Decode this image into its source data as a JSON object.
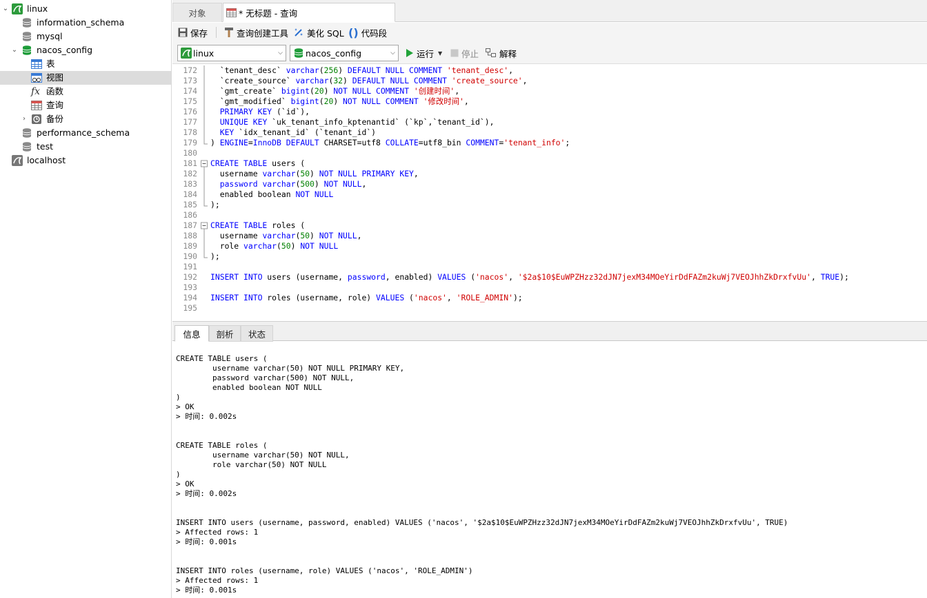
{
  "tree": {
    "connection": "linux",
    "databases": [
      "information_schema",
      "mysql",
      "nacos_config"
    ],
    "nacos_children": [
      "表",
      "视图",
      "函数",
      "查询",
      "备份"
    ],
    "more_databases": [
      "performance_schema",
      "test"
    ],
    "other_connection": "localhost"
  },
  "tabs": {
    "objects": "对象",
    "query_tab": "* 无标题 - 查询"
  },
  "toolbar": {
    "save": "保存",
    "query_builder": "查询创建工具",
    "beautify": "美化 SQL",
    "snippet": "代码段",
    "connection": "linux",
    "database": "nacos_config",
    "run": "运行",
    "stop": "停止",
    "explain": "解释"
  },
  "colors": {
    "keyword": "#0000ff",
    "string": "#d00000",
    "number": "#008000",
    "selected_row": "#dcdcdc"
  },
  "editor": {
    "lines": [
      {
        "n": "172",
        "html": "  `tenant_desc` <span class='kw'>varchar</span>(<span class='num'>256</span>) <span class='kw'>DEFAULT NULL COMMENT</span> <span class='str'>'tenant_desc'</span>,"
      },
      {
        "n": "173",
        "html": "  `create_source` <span class='kw'>varchar</span>(<span class='num'>32</span>) <span class='kw'>DEFAULT NULL COMMENT</span> <span class='str'>'create_source'</span>,"
      },
      {
        "n": "174",
        "html": "  `gmt_create` <span class='kw'>bigint</span>(<span class='num'>20</span>) <span class='kw'>NOT NULL COMMENT</span> <span class='str'>'创建时间'</span>,"
      },
      {
        "n": "175",
        "html": "  `gmt_modified` <span class='kw'>bigint</span>(<span class='num'>20</span>) <span class='kw'>NOT NULL COMMENT</span> <span class='str'>'修改时间'</span>,"
      },
      {
        "n": "176",
        "html": "  <span class='kw'>PRIMARY KEY</span> (`id`),"
      },
      {
        "n": "177",
        "html": "  <span class='kw'>UNIQUE KEY</span> `uk_tenant_info_kptenantid` (`kp`,`tenant_id`),"
      },
      {
        "n": "178",
        "html": "  <span class='kw'>KEY</span> `idx_tenant_id` (`tenant_id`)"
      },
      {
        "n": "179",
        "html": ") <span class='kw'>ENGINE</span>=<span class='kw'>InnoDB</span> <span class='kw'>DEFAULT</span> CHARSET=utf8 <span class='kw'>COLLATE</span>=utf8_bin <span class='kw'>COMMENT</span>=<span class='str'>'tenant_info'</span>;"
      },
      {
        "n": "180",
        "html": ""
      },
      {
        "n": "181",
        "html": "<span class='kw'>CREATE TABLE</span> users ("
      },
      {
        "n": "182",
        "html": "  username <span class='kw'>varchar</span>(<span class='num'>50</span>) <span class='kw'>NOT NULL PRIMARY KEY</span>,"
      },
      {
        "n": "183",
        "html": "  <span class='kw'>password</span> <span class='kw'>varchar</span>(<span class='num'>500</span>) <span class='kw'>NOT NULL</span>,"
      },
      {
        "n": "184",
        "html": "  enabled boolean <span class='kw'>NOT NULL</span>"
      },
      {
        "n": "185",
        "html": ");"
      },
      {
        "n": "186",
        "html": ""
      },
      {
        "n": "187",
        "html": "<span class='kw'>CREATE TABLE</span> roles ("
      },
      {
        "n": "188",
        "html": "  username <span class='kw'>varchar</span>(<span class='num'>50</span>) <span class='kw'>NOT NULL</span>,"
      },
      {
        "n": "189",
        "html": "  role <span class='kw'>varchar</span>(<span class='num'>50</span>) <span class='kw'>NOT NULL</span>"
      },
      {
        "n": "190",
        "html": ");"
      },
      {
        "n": "191",
        "html": ""
      },
      {
        "n": "192",
        "html": "<span class='kw'>INSERT INTO</span> users (username, <span class='kw'>password</span>, enabled) <span class='kw'>VALUES</span> (<span class='str'>'nacos'</span>, <span class='str'>'$2a$10$EuWPZHzz32dJN7jexM34MOeYirDdFAZm2kuWj7VEOJhhZkDrxfvUu'</span>, <span class='kw'>TRUE</span>);"
      },
      {
        "n": "193",
        "html": ""
      },
      {
        "n": "194",
        "html": "<span class='kw'>INSERT INTO</span> roles (username, role) <span class='kw'>VALUES</span> (<span class='str'>'nacos'</span>, <span class='str'>'ROLE_ADMIN'</span>);"
      },
      {
        "n": "195",
        "html": ""
      }
    ]
  },
  "result_tabs": [
    "信息",
    "剖析",
    "状态"
  ],
  "output": {
    "lines": [
      "CREATE TABLE users (",
      "        username varchar(50) NOT NULL PRIMARY KEY,",
      "        password varchar(500) NOT NULL,",
      "        enabled boolean NOT NULL",
      ")",
      "> OK",
      "> 时间: 0.002s",
      "",
      "",
      "CREATE TABLE roles (",
      "        username varchar(50) NOT NULL,",
      "        role varchar(50) NOT NULL",
      ")",
      "> OK",
      "> 时间: 0.002s",
      "",
      "",
      "INSERT INTO users (username, password, enabled) VALUES ('nacos', '$2a$10$EuWPZHzz32dJN7jexM34MOeYirDdFAZm2kuWj7VEOJhhZkDrxfvUu', TRUE)",
      "> Affected rows: 1",
      "> 时间: 0.001s",
      "",
      "",
      "INSERT INTO roles (username, role) VALUES ('nacos', 'ROLE_ADMIN')",
      "> Affected rows: 1",
      "> 时间: 0.001s"
    ]
  }
}
